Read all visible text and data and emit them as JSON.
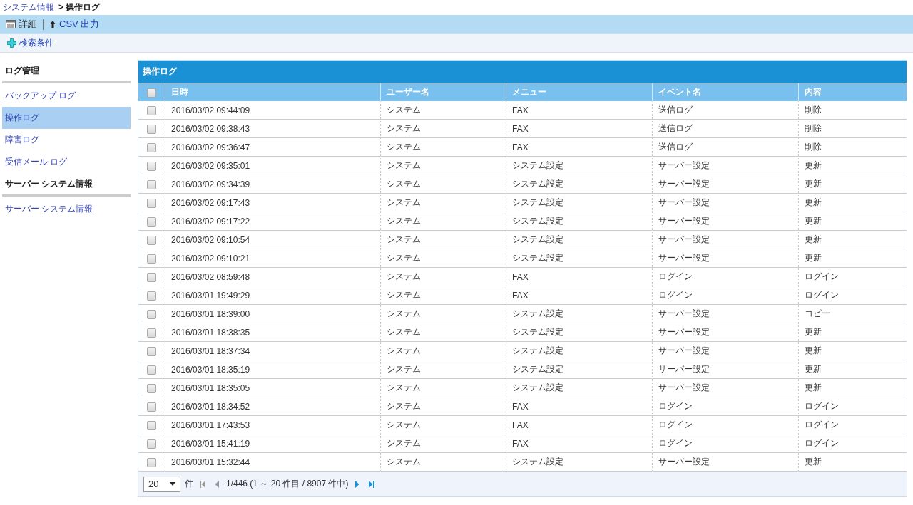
{
  "breadcrumb": [
    {
      "label": "システム情報",
      "kind": "link"
    },
    {
      "label": "> 操作ログ",
      "kind": "current"
    }
  ],
  "toolbar": [
    {
      "label": "詳細",
      "kind": "detail"
    },
    {
      "label": "CSV 出力",
      "kind": "csv"
    }
  ],
  "search_bar": {
    "label": "検索条件"
  },
  "sidebar": [
    {
      "label": "ログ管理",
      "kind": "heading"
    },
    {
      "label": "バックアップ ログ",
      "kind": "link",
      "selected": false
    },
    {
      "label": "操作ログ",
      "kind": "link",
      "selected": true
    },
    {
      "label": "障害ログ",
      "kind": "link",
      "selected": false
    },
    {
      "label": "受信メール ログ",
      "kind": "link",
      "selected": false
    },
    {
      "label": "サーバー システム情報",
      "kind": "heading"
    },
    {
      "label": "サーバー システム情報",
      "kind": "link",
      "selected": false
    }
  ],
  "panel": {
    "title": "操作ログ",
    "table": {
      "columns": [
        "日時",
        "ユーザー名",
        "メニュー",
        "イベント名",
        "内容"
      ],
      "all_checked": false,
      "rows": [
        {
          "checked": false,
          "cells": [
            "2016/03/02 09:44:09",
            "システム",
            "FAX",
            "送信ログ",
            "削除"
          ]
        },
        {
          "checked": false,
          "cells": [
            "2016/03/02 09:38:43",
            "システム",
            "FAX",
            "送信ログ",
            "削除"
          ]
        },
        {
          "checked": false,
          "cells": [
            "2016/03/02 09:36:47",
            "システム",
            "FAX",
            "送信ログ",
            "削除"
          ]
        },
        {
          "checked": false,
          "cells": [
            "2016/03/02 09:35:01",
            "システム",
            "システム設定",
            "サーバー設定",
            "更新"
          ]
        },
        {
          "checked": false,
          "cells": [
            "2016/03/02 09:34:39",
            "システム",
            "システム設定",
            "サーバー設定",
            "更新"
          ]
        },
        {
          "checked": false,
          "cells": [
            "2016/03/02 09:17:43",
            "システム",
            "システム設定",
            "サーバー設定",
            "更新"
          ]
        },
        {
          "checked": false,
          "cells": [
            "2016/03/02 09:17:22",
            "システム",
            "システム設定",
            "サーバー設定",
            "更新"
          ]
        },
        {
          "checked": false,
          "cells": [
            "2016/03/02 09:10:54",
            "システム",
            "システム設定",
            "サーバー設定",
            "更新"
          ]
        },
        {
          "checked": false,
          "cells": [
            "2016/03/02 09:10:21",
            "システム",
            "システム設定",
            "サーバー設定",
            "更新"
          ]
        },
        {
          "checked": false,
          "cells": [
            "2016/03/02 08:59:48",
            "システム",
            "FAX",
            "ログイン",
            "ログイン"
          ]
        },
        {
          "checked": false,
          "cells": [
            "2016/03/01 19:49:29",
            "システム",
            "FAX",
            "ログイン",
            "ログイン"
          ]
        },
        {
          "checked": false,
          "cells": [
            "2016/03/01 18:39:00",
            "システム",
            "システム設定",
            "サーバー設定",
            "コピー"
          ]
        },
        {
          "checked": false,
          "cells": [
            "2016/03/01 18:38:35",
            "システム",
            "システム設定",
            "サーバー設定",
            "更新"
          ]
        },
        {
          "checked": false,
          "cells": [
            "2016/03/01 18:37:34",
            "システム",
            "システム設定",
            "サーバー設定",
            "更新"
          ]
        },
        {
          "checked": false,
          "cells": [
            "2016/03/01 18:35:19",
            "システム",
            "システム設定",
            "サーバー設定",
            "更新"
          ]
        },
        {
          "checked": false,
          "cells": [
            "2016/03/01 18:35:05",
            "システム",
            "システム設定",
            "サーバー設定",
            "更新"
          ]
        },
        {
          "checked": false,
          "cells": [
            "2016/03/01 18:34:52",
            "システム",
            "FAX",
            "ログイン",
            "ログイン"
          ]
        },
        {
          "checked": false,
          "cells": [
            "2016/03/01 17:43:53",
            "システム",
            "FAX",
            "ログイン",
            "ログイン"
          ]
        },
        {
          "checked": false,
          "cells": [
            "2016/03/01 15:41:19",
            "システム",
            "FAX",
            "ログイン",
            "ログイン"
          ]
        },
        {
          "checked": false,
          "cells": [
            "2016/03/01 15:32:44",
            "システム",
            "システム設定",
            "サーバー設定",
            "更新"
          ]
        }
      ]
    },
    "pager": {
      "page_size": "20",
      "unit": "件",
      "info": "1/446 (1 ～ 20 件目 / 8907 件中)",
      "first_disabled": true,
      "prev_disabled": true,
      "next_disabled": false,
      "last_disabled": false
    }
  }
}
